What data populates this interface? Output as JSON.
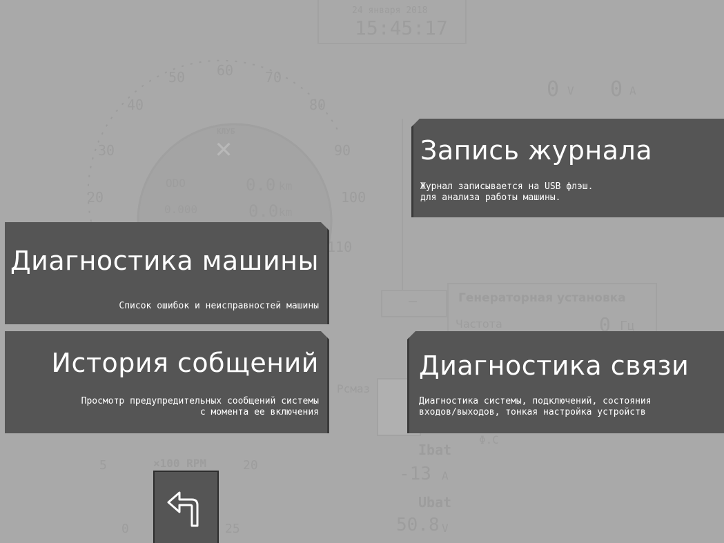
{
  "header": {
    "date": "24 января 2018",
    "time": "15:45:17"
  },
  "gauge": {
    "ticks": [
      "50",
      "60",
      "70",
      "40",
      "80",
      "30",
      "90",
      "20",
      "100",
      "110"
    ],
    "klub_label": "КЛУБ",
    "odo_label": "ODO",
    "odo_value": "0.0",
    "odo_unit": "km",
    "trip_label": "0.000",
    "trip_value": "0.0",
    "trip_unit": "km",
    "rpm_label": "×100 RPM",
    "rpm_ticks": [
      "5",
      "20",
      "0",
      "25"
    ]
  },
  "electrics": {
    "voltage_value": "0",
    "voltage_unit": "V",
    "current_value": "0",
    "current_unit": "A",
    "ibat_label": "Ibat",
    "ibat_value": "-13",
    "ibat_unit": "A",
    "ubat_label": "Ubat",
    "ubat_value": "50.8",
    "ubat_unit": "V",
    "pcmaz_label": "Pсмаз"
  },
  "generator": {
    "title": "Генераторная установка",
    "freq_label": "Частота",
    "freq_value": "0",
    "freq_unit": "Гц",
    "phi_label": "Φ.С"
  },
  "menu": {
    "journal": {
      "title": "Запись журнала",
      "desc_line1": "Журнал записывается на USB флэш.",
      "desc_line2": "для анализа работы машины."
    },
    "diag_machine": {
      "title": "Диагностика машины",
      "desc": "Список ошибок и неисправностей машины"
    },
    "history": {
      "title": "История собщений",
      "desc_line1": "Просмотр предупредительных сообщений системы",
      "desc_line2": "с момента ее включения"
    },
    "diag_link": {
      "title": "Диагностика связи",
      "desc_line1": "Диагностика системы, подключений, состояния",
      "desc_line2": "входов/выходов, тонкая настройка устройств"
    }
  },
  "back_button": {
    "icon": "back-arrow-icon"
  }
}
